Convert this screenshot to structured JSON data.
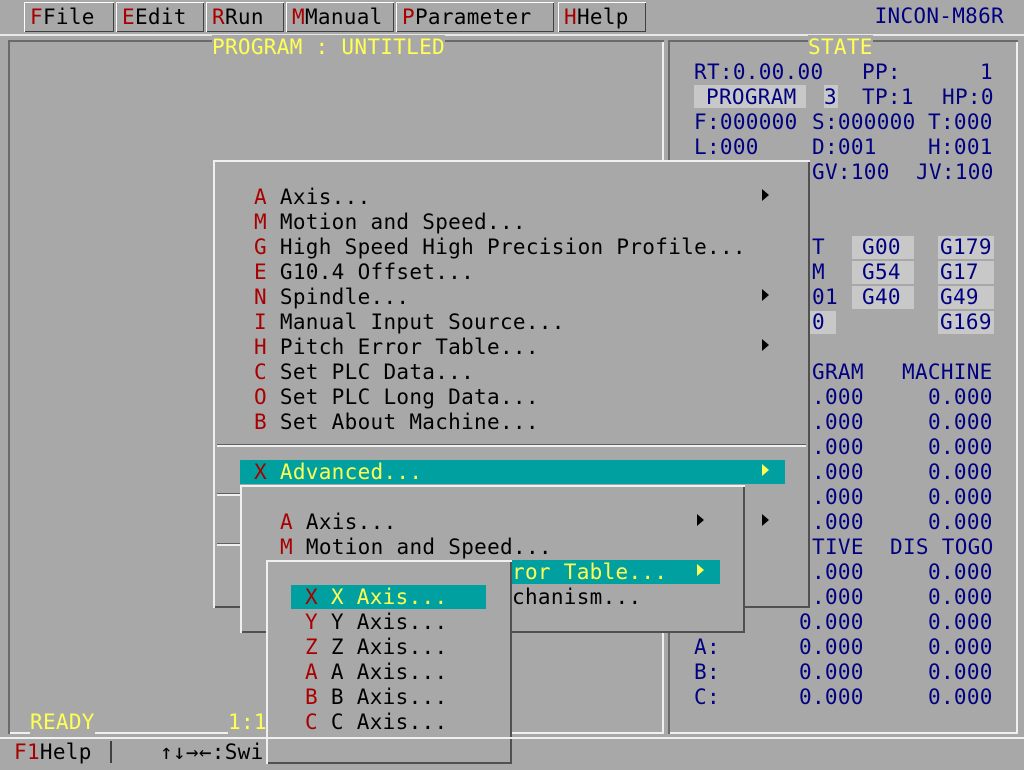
{
  "menubar": {
    "items": [
      {
        "hot": "F",
        "label": "File"
      },
      {
        "hot": "E",
        "label": "Edit"
      },
      {
        "hot": "R",
        "label": "Run"
      },
      {
        "hot": "M",
        "label": "Manual"
      },
      {
        "hot": "P",
        "label": "Parameter"
      },
      {
        "hot": "H",
        "label": "Help"
      }
    ],
    "brand": "INCON-M86R"
  },
  "program_panel": {
    "title": "PROGRAM : UNTITLED",
    "status": "READY",
    "scale": "1:1"
  },
  "state_panel": {
    "title": "STATE",
    "rt": "RT:0.00.00",
    "pp_label": "PP:",
    "pp_value": "1",
    "mode": "PROGRAM",
    "mode_num": "3",
    "tp": "TP:1",
    "hp": "HP:0",
    "f": "F:000000",
    "s": "S:000000",
    "t": "T:000",
    "l": "L:000",
    "d": "D:001",
    "h": "H:001",
    "gv": "GV:100",
    "jv": "JV:100",
    "gcode_rows": [
      [
        "T",
        "G00",
        "G179"
      ],
      [
        "M",
        "G54",
        "G17"
      ],
      [
        "01",
        "G40",
        "G49"
      ],
      [
        "0",
        "",
        "G169"
      ]
    ],
    "pos_header": [
      "GRAM",
      "MACHINE"
    ],
    "pos_rows": [
      [
        ".000",
        "0.000"
      ],
      [
        ".000",
        "0.000"
      ],
      [
        ".000",
        "0.000"
      ],
      [
        ".000",
        "0.000"
      ],
      [
        ".000",
        "0.000"
      ],
      [
        ".000",
        "0.000"
      ]
    ],
    "rel_header": [
      "TIVE",
      "DIS TOGO"
    ],
    "rel_rows": [
      {
        "axis": "",
        "a": ".000",
        "b": "0.000"
      },
      {
        "axis": "",
        "a": ".000",
        "b": "0.000"
      },
      {
        "axis": "",
        "a": "0.000",
        "b": "0.000"
      },
      {
        "axis": "A:",
        "a": "0.000",
        "b": "0.000"
      },
      {
        "axis": "B:",
        "a": "0.000",
        "b": "0.000"
      },
      {
        "axis": "C:",
        "a": "0.000",
        "b": "0.000"
      }
    ]
  },
  "parameter_menu": {
    "items": [
      {
        "hot": "A",
        "label": "Axis..."
      },
      {
        "hot": "M",
        "label": "Motion and Speed..."
      },
      {
        "hot": "G",
        "label": "High Speed High Precision Profile..."
      },
      {
        "hot": "E",
        "label": "G10.4 Offset..."
      },
      {
        "hot": "N",
        "label": "Spindle..."
      },
      {
        "hot": "I",
        "label": "Manual Input Source..."
      },
      {
        "hot": "H",
        "label": "Pitch Error Table..."
      },
      {
        "hot": "C",
        "label": "Set PLC Data..."
      },
      {
        "hot": "O",
        "label": "Set PLC Long Data..."
      },
      {
        "hot": "B",
        "label": "Set About Machine..."
      }
    ],
    "advanced": {
      "hot": "X",
      "label": "Advanced..."
    }
  },
  "advanced_menu": {
    "items": [
      {
        "hot": "A",
        "label": "Axis..."
      },
      {
        "hot": "M",
        "label": "Motion and Speed..."
      }
    ],
    "partial_selected": "ror Table...",
    "partial_item": "chanism..."
  },
  "axis_menu": {
    "items": [
      {
        "hot": "X",
        "label": "X Axis..."
      },
      {
        "hot": "Y",
        "label": "Y Axis..."
      },
      {
        "hot": "Z",
        "label": "Z Axis..."
      },
      {
        "hot": "A",
        "label": "A Axis..."
      },
      {
        "hot": "B",
        "label": "B Axis..."
      },
      {
        "hot": "C",
        "label": "C Axis..."
      }
    ]
  },
  "statusbar": {
    "help_key": "F1",
    "help_label": "Help",
    "hint": "↑↓→←:Swi"
  }
}
